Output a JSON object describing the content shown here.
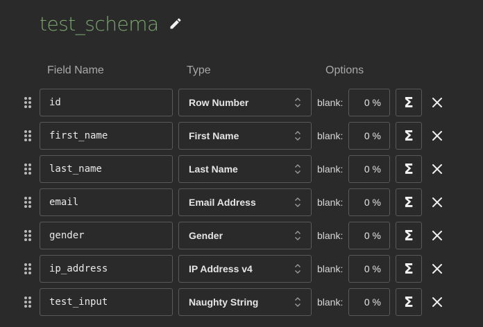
{
  "schema": {
    "title": "test_schema"
  },
  "headers": {
    "field_name": "Field Name",
    "type": "Type",
    "options": "Options"
  },
  "icons": {
    "edit": "pencil-icon",
    "drag": "drag-handle-icon",
    "type_select": "chevron-up-down-icon",
    "formula": "sigma-icon",
    "remove": "close-icon"
  },
  "colors": {
    "background": "#2a2a2a",
    "title": "#7aa86e",
    "border": "#5a5a5a",
    "text": "#e6e6e6",
    "header_text": "#a9a9a9"
  },
  "sigma_glyph": "Σ",
  "fields": [
    {
      "name": "id",
      "type": "Row Number",
      "blank_label": "blank:",
      "blank_value": "0 %"
    },
    {
      "name": "first_name",
      "type": "First Name",
      "blank_label": "blank:",
      "blank_value": "0 %"
    },
    {
      "name": "last_name",
      "type": "Last Name",
      "blank_label": "blank:",
      "blank_value": "0 %"
    },
    {
      "name": "email",
      "type": "Email Address",
      "blank_label": "blank:",
      "blank_value": "0 %"
    },
    {
      "name": "gender",
      "type": "Gender",
      "blank_label": "blank:",
      "blank_value": "0 %"
    },
    {
      "name": "ip_address",
      "type": "IP Address v4",
      "blank_label": "blank:",
      "blank_value": "0 %"
    },
    {
      "name": "test_input",
      "type": "Naughty String",
      "blank_label": "blank:",
      "blank_value": "0 %"
    }
  ]
}
